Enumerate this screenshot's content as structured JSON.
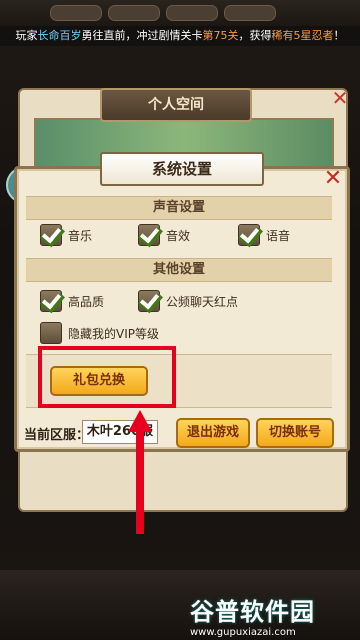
{
  "ticker": {
    "part1": "玩家",
    "player": "长命百岁",
    "part2": "勇往直前，冲过剧情关卡",
    "stage": "第75关",
    "part3": "，获得",
    "reward": "稀有5星忍者",
    "part4": "！"
  },
  "space_panel": {
    "title": "个人空间"
  },
  "dialog": {
    "title": "系统设置",
    "sound_section": "声音设置",
    "sound_options": [
      {
        "label": "音乐",
        "checked": true
      },
      {
        "label": "音效",
        "checked": true
      },
      {
        "label": "语音",
        "checked": true
      }
    ],
    "other_section": "其他设置",
    "other_options": [
      {
        "label": "高品质",
        "checked": true
      },
      {
        "label": "公频聊天红点",
        "checked": true
      },
      {
        "label": "隐藏我的VIP等级",
        "checked": false
      }
    ],
    "gift_button": "礼包兑换",
    "server_label": "当前区服：",
    "server_value": "木叶266服",
    "exit_button": "退出游戏",
    "switch_button": "切换账号"
  },
  "watermark": {
    "title": "谷普软件园",
    "url": "www.gupuxiazai.com"
  },
  "colors": {
    "highlight_red": "#e6001e",
    "button_gold": "#f3a91a"
  }
}
